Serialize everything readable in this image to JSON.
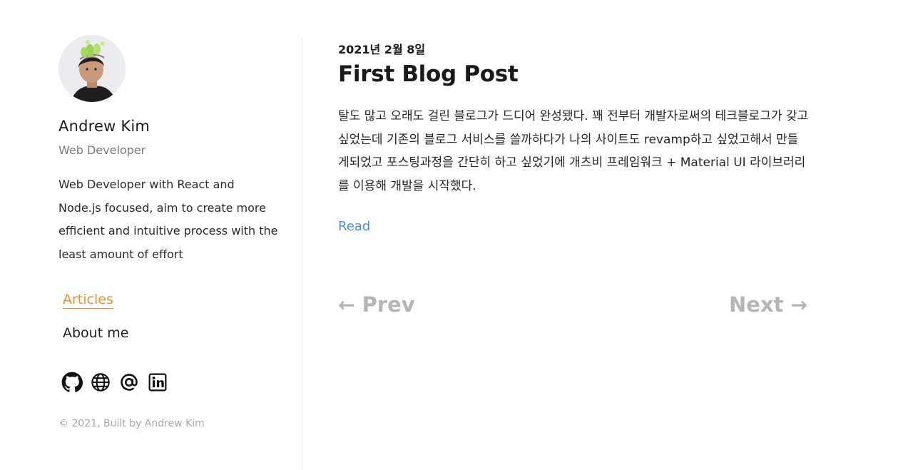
{
  "sidebar": {
    "name": "Andrew Kim",
    "role": "Web Developer",
    "bio": "Web Developer with React and Node.js focused, aim to create more efficient and intuitive process with the least amount of effort",
    "nav": [
      {
        "label": "Articles",
        "active": true
      },
      {
        "label": "About me",
        "active": false
      }
    ],
    "socials": [
      "github-icon",
      "globe-icon",
      "at-sign-icon",
      "linkedin-icon"
    ],
    "copyright": "© 2021, Built by Andrew Kim"
  },
  "post": {
    "date": "2021년 2월 8일",
    "title": "First Blog Post",
    "excerpt": "탈도 많고 오래도 걸린 블로그가 드디어 완성됐다. 꽤 전부터 개발자로써의 테크블로그가 갖고 싶었는데 기존의 블로그 서비스를 쓸까하다가 나의 사이트도 revamp하고 싶었고해서 만들게되었고 포스팅과정을 간단히 하고 싶었기에 개츠비 프레임워크 + Material UI 라이브러리를 이용해 개발을 시작했다.",
    "read_label": "Read"
  },
  "pagination": {
    "prev_label": "Prev",
    "next_label": "Next",
    "prev_arrow": "←",
    "next_arrow": "→"
  },
  "colors": {
    "accent": "#e8913a",
    "link": "#4a8fe6",
    "muted": "#b5b5b5"
  }
}
